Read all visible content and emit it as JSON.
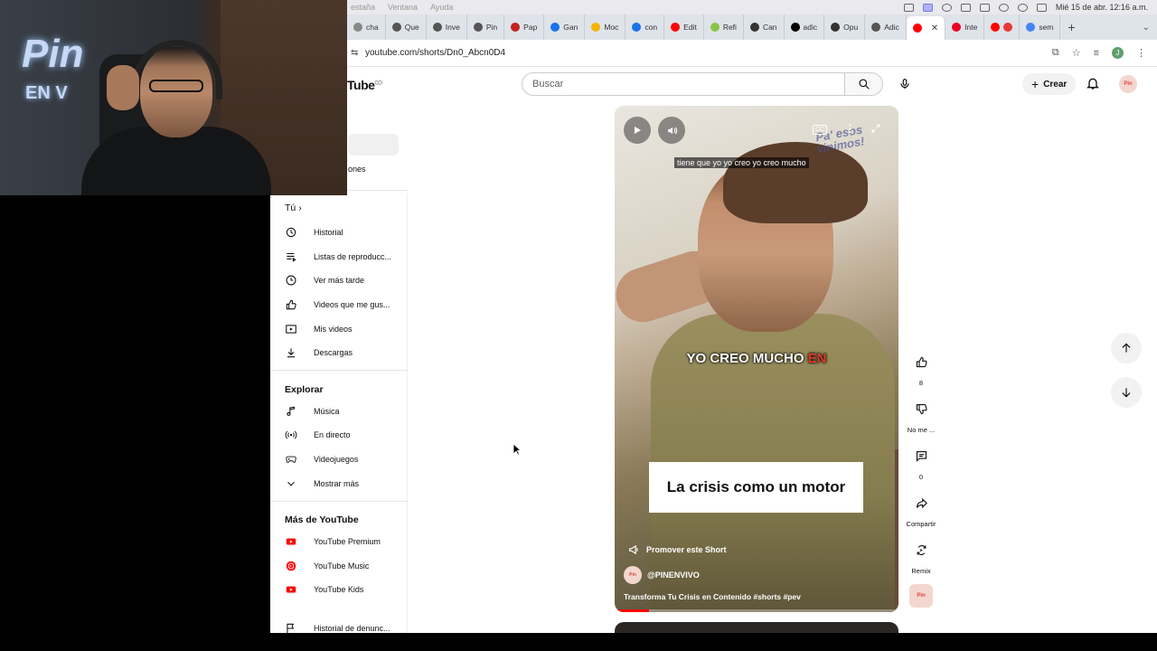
{
  "os_bar": {
    "menus": [
      "estaña",
      "Ventana",
      "Ayuda"
    ],
    "datetime": "Mié 15 de abr. 12:16 a.m."
  },
  "tabs": [
    {
      "label": "cha",
      "color": "#888888"
    },
    {
      "label": "Que",
      "color": "#555555"
    },
    {
      "label": "Inve",
      "color": "#555555"
    },
    {
      "label": "Pin",
      "color": "#555555"
    },
    {
      "label": "Pap",
      "color": "#c5221f"
    },
    {
      "label": "Gan",
      "color": "#1a73e8"
    },
    {
      "label": "Moc",
      "color": "#f4b400"
    },
    {
      "label": "con",
      "color": "#1a73e8"
    },
    {
      "label": "Edit",
      "color": "#ff0000"
    },
    {
      "label": "Refi",
      "color": "#8bc34a"
    },
    {
      "label": "Can",
      "color": "#333333"
    },
    {
      "label": "adic",
      "color": "#000000"
    },
    {
      "label": "Opu",
      "color": "#333333"
    },
    {
      "label": "Adic",
      "color": "#555555"
    },
    {
      "label": "Inte",
      "color": "#e60023"
    },
    {
      "label": "sem",
      "color": "#4285f4"
    }
  ],
  "address_bar": {
    "url": "youtube.com/shorts/Dn0_Abcn0D4"
  },
  "header": {
    "logo": "Tube",
    "logo_country": "CO",
    "search_placeholder": "Buscar",
    "create_label": "Crear",
    "avatar_text": "Pin"
  },
  "sidebar": {
    "hidden_label": "ones",
    "you_heading": "Tú",
    "you_items": [
      {
        "label": "Historial",
        "icon": "history-icon"
      },
      {
        "label": "Listas de reproducc...",
        "icon": "playlist-icon"
      },
      {
        "label": "Ver más tarde",
        "icon": "clock-icon"
      },
      {
        "label": "Videos que me gus...",
        "icon": "thumbs-up-icon"
      },
      {
        "label": "Mis videos",
        "icon": "play-square-icon"
      },
      {
        "label": "Descargas",
        "icon": "download-icon"
      }
    ],
    "explore_heading": "Explorar",
    "explore_items": [
      {
        "label": "Música",
        "icon": "music-note-icon"
      },
      {
        "label": "En directo",
        "icon": "live-icon"
      },
      {
        "label": "Videojuegos",
        "icon": "gamepad-icon"
      },
      {
        "label": "Mostrar más",
        "icon": "chevron-down-icon"
      }
    ],
    "more_heading": "Más de YouTube",
    "more_items": [
      {
        "label": "YouTube Premium",
        "icon": "youtube-premium-icon"
      },
      {
        "label": "YouTube Music",
        "icon": "youtube-music-icon"
      },
      {
        "label": "YouTube Kids",
        "icon": "youtube-kids-icon"
      },
      {
        "label": "Historial de denunc...",
        "icon": "flag-icon"
      }
    ]
  },
  "player": {
    "cc": "CC",
    "watermark_line1": "Pa' esos",
    "watermark_line2": "vinimos!",
    "subtitle": "tiene que yo yo creo yo creo mucho",
    "caption_main": "YO CREO MUCHO",
    "caption_accent": "EN",
    "title_card": "La crisis como un motor",
    "promote_label": "Promover este Short",
    "channel": "@PINENVIVO",
    "description": "Transforma Tu Crisis en Contenido #shorts #pev",
    "progress": 0.12
  },
  "actions": {
    "like_count": "8",
    "dislike_label": "No me ...",
    "comment_count": "0",
    "share_label": "Compartir",
    "remix_label": "Remix",
    "channel_thumb_text": "Pin"
  },
  "webcam": {
    "neon_text": "Pin",
    "neon_sub": "EN V"
  },
  "colors": {
    "youtube_red": "#ff0000",
    "caption_accent": "#e23b2a"
  }
}
